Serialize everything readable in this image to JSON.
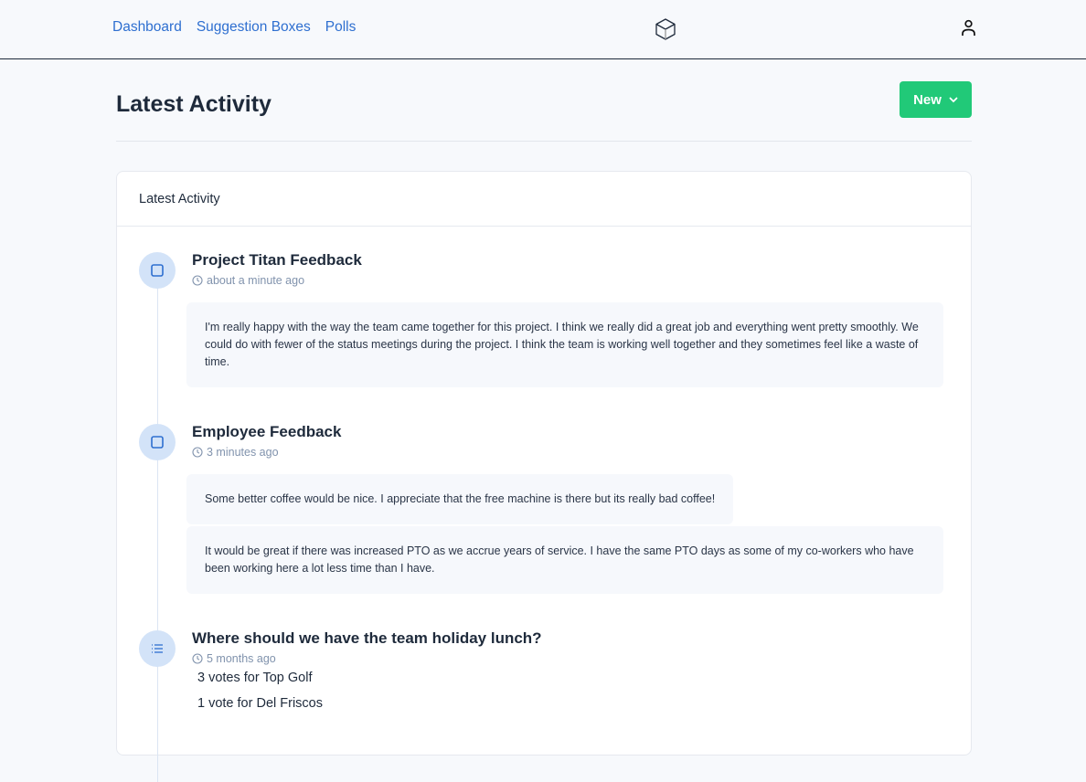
{
  "nav": {
    "links": [
      "Dashboard",
      "Suggestion Boxes",
      "Polls"
    ]
  },
  "header": {
    "title": "Latest Activity",
    "new_button": "New"
  },
  "card": {
    "title": "Latest Activity",
    "items": [
      {
        "type": "suggestion-box",
        "title": "Project Titan Feedback",
        "time": "about a minute ago",
        "responses": [
          "I'm really happy with the way the team came together for this project. I think we really did a great job and everything went pretty smoothly. We could do with fewer of the status meetings during the project. I think the team is working well together and they sometimes feel like a waste of time."
        ]
      },
      {
        "type": "suggestion-box",
        "title": "Employee Feedback",
        "time": "3 minutes ago",
        "responses": [
          "Some better coffee would be nice. I appreciate that the free machine is there but its really bad coffee!",
          "It would be great if there was increased PTO as we accrue years of service. I have the same PTO days as some of my co-workers who have been working here a lot less time than I have."
        ]
      },
      {
        "type": "poll",
        "title": "Where should we have the team holiday lunch?",
        "time": "5 months ago",
        "votes": [
          "3 votes for Top Golf",
          "1 vote for Del Friscos"
        ]
      }
    ]
  },
  "colors": {
    "link": "#2e6fd0",
    "accent_green": "#21c978",
    "bubble": "#d3e3f8",
    "icon_blue": "#2e6fd0"
  }
}
